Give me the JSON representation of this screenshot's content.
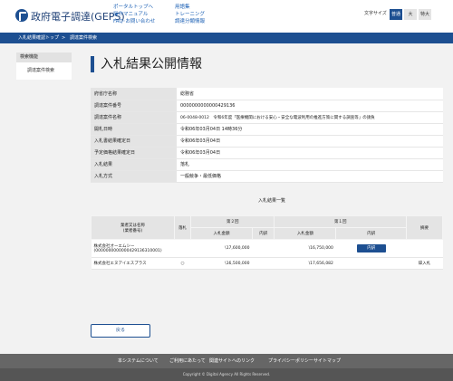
{
  "header": {
    "logo_text": "政府電子調達(GEPS)",
    "nav_col1": [
      "ポータルトップへ",
      "操作マニュアル",
      "FAQ･お問い合わせ"
    ],
    "nav_col2": [
      "用語集",
      "トレーニング",
      "調達分類情報"
    ],
    "font_size_label": "文字サイズ",
    "font_sizes": [
      "普通",
      "大",
      "特大"
    ]
  },
  "breadcrumb": {
    "items": [
      "入札結果確認トップ",
      "調達案件検索"
    ],
    "separator": ">"
  },
  "sidebar": {
    "header": "検索機能",
    "item": "調達案件検索"
  },
  "page": {
    "title": "入札結果公開情報"
  },
  "info_rows": [
    {
      "label": "府省庁名称",
      "value": "総務省"
    },
    {
      "label": "調達案件番号",
      "value": "0000000000000429136"
    },
    {
      "label": "調達案件名称",
      "value": "06-0048-0012　令和6年度「医療機関における安心・安全な電波利用の推進方策に関する調査等」の請負"
    },
    {
      "label": "開札日時",
      "value": "令和06年03月04日 14時36分"
    },
    {
      "label": "入札書結果確定日",
      "value": "令和06年03月04日"
    },
    {
      "label": "予定価格結果確定日",
      "value": "令和06年03月04日"
    },
    {
      "label": "入札結果",
      "value": "落札"
    },
    {
      "label": "入札方式",
      "value": "一般競争・最低価格"
    }
  ],
  "results": {
    "heading": "入札結果一覧",
    "col_company": "業者又は名称\n(業者番号)",
    "col_award": "落札",
    "round2": "第２回",
    "round1": "第１回",
    "col_amount": "入札金額",
    "col_detail": "内訳",
    "col_withdraw": "摘要",
    "rows": [
      {
        "company": "株式会社オーエムシー\n(0000000000000429136310001)",
        "award": "",
        "amount2": "\\17,600,000",
        "detail2": "",
        "amount1": "\\16,750,000",
        "detail1": "内訳",
        "note": ""
      },
      {
        "company": "株式会社エヌアイエスプラス",
        "award": "○",
        "amount2": "\\16,500,000",
        "detail2": "",
        "amount1": "\\17,656,082",
        "detail1": "",
        "note": "辞入札"
      }
    ]
  },
  "back_label": "戻る",
  "footer": {
    "links": [
      "本システムについて",
      "ご利用にあたって",
      "関連サイトへのリンク",
      "プライバシーポリシー",
      "サイトマップ"
    ],
    "copyright": "Copyright © Digital Agency All Rights Reserved."
  }
}
